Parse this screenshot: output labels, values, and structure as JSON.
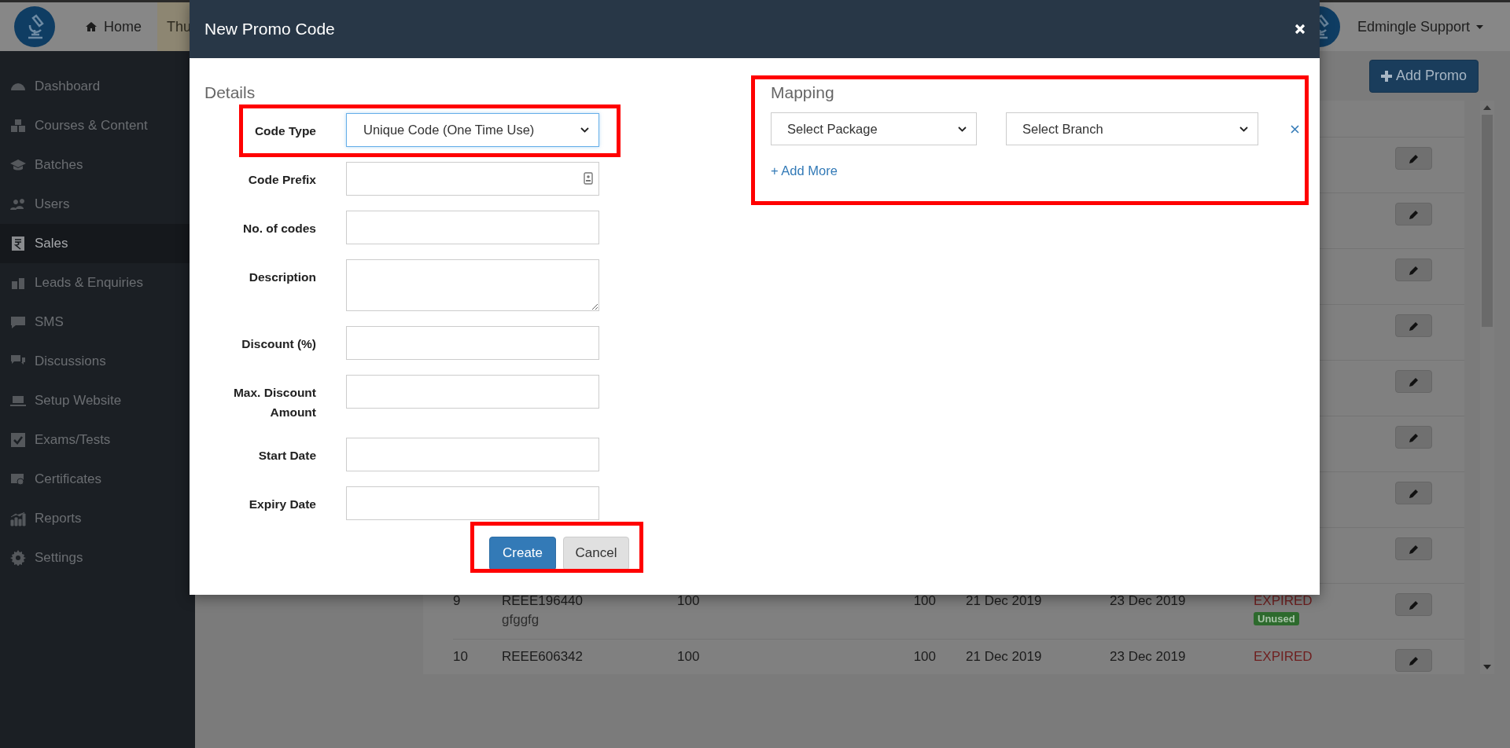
{
  "top_nav": {
    "items": [
      {
        "label": "Home",
        "selected": false
      },
      {
        "label": "Thu",
        "selected": true
      }
    ]
  },
  "user_menu": {
    "label": "Edmingle Support"
  },
  "sidebar": {
    "items": [
      {
        "label": "Dashboard",
        "selected": false
      },
      {
        "label": "Courses & Content",
        "selected": false
      },
      {
        "label": "Batches",
        "selected": false
      },
      {
        "label": "Users",
        "selected": false
      },
      {
        "label": "Sales",
        "selected": true
      },
      {
        "label": "Leads & Enquiries",
        "selected": false
      },
      {
        "label": "SMS",
        "selected": false
      },
      {
        "label": "Discussions",
        "selected": false
      },
      {
        "label": "Setup Website",
        "selected": false
      },
      {
        "label": "Exams/Tests",
        "selected": false
      },
      {
        "label": "Certificates",
        "selected": false
      },
      {
        "label": "Reports",
        "selected": false
      },
      {
        "label": "Settings",
        "selected": false
      }
    ]
  },
  "toolbar": {
    "add_button": "Add Promo"
  },
  "table": {
    "rows": [
      {
        "kind": "covered"
      },
      {
        "kind": "covered"
      },
      {
        "kind": "covered"
      },
      {
        "kind": "covered"
      },
      {
        "kind": "covered"
      },
      {
        "kind": "covered"
      },
      {
        "kind": "covered"
      },
      {
        "kind": "covered"
      },
      {
        "kind": "full",
        "number": "9",
        "code": "REEE196440",
        "note": "gfggfg",
        "column_3": "100",
        "column_4": "100",
        "start_date": "21 Dec 2019",
        "end_date": "23 Dec 2019",
        "status": "EXPIRED",
        "badge": "Unused"
      },
      {
        "kind": "full",
        "number": "10",
        "code": "REEE606342",
        "column_3": "100",
        "column_4": "100",
        "start_date": "21 Dec 2019",
        "end_date": "23 Dec 2019",
        "status": "EXPIRED"
      }
    ]
  },
  "modal": {
    "title": "New Promo Code",
    "details": {
      "heading": "Details",
      "fields": [
        {
          "label": "Code Type",
          "kind": "select",
          "value": "Unique Code (One Time Use)",
          "focused": true
        },
        {
          "label": "Code Prefix",
          "kind": "text",
          "autofill_icon": true
        },
        {
          "label": "No. of codes",
          "kind": "text"
        },
        {
          "label": "Description",
          "kind": "textarea"
        },
        {
          "label": "Discount (%)",
          "kind": "text"
        },
        {
          "label": "Max. Discount Amount",
          "kind": "text"
        },
        {
          "label": "Start Date",
          "kind": "text"
        },
        {
          "label": "Expiry Date",
          "kind": "text"
        }
      ]
    },
    "mapping": {
      "heading": "Mapping",
      "selects": [
        "Select Package",
        "Select Branch"
      ],
      "add_more": "+ Add More"
    },
    "buttons": [
      {
        "label": "Create",
        "kind": "primary"
      },
      {
        "label": "Cancel",
        "kind": "default"
      }
    ]
  }
}
